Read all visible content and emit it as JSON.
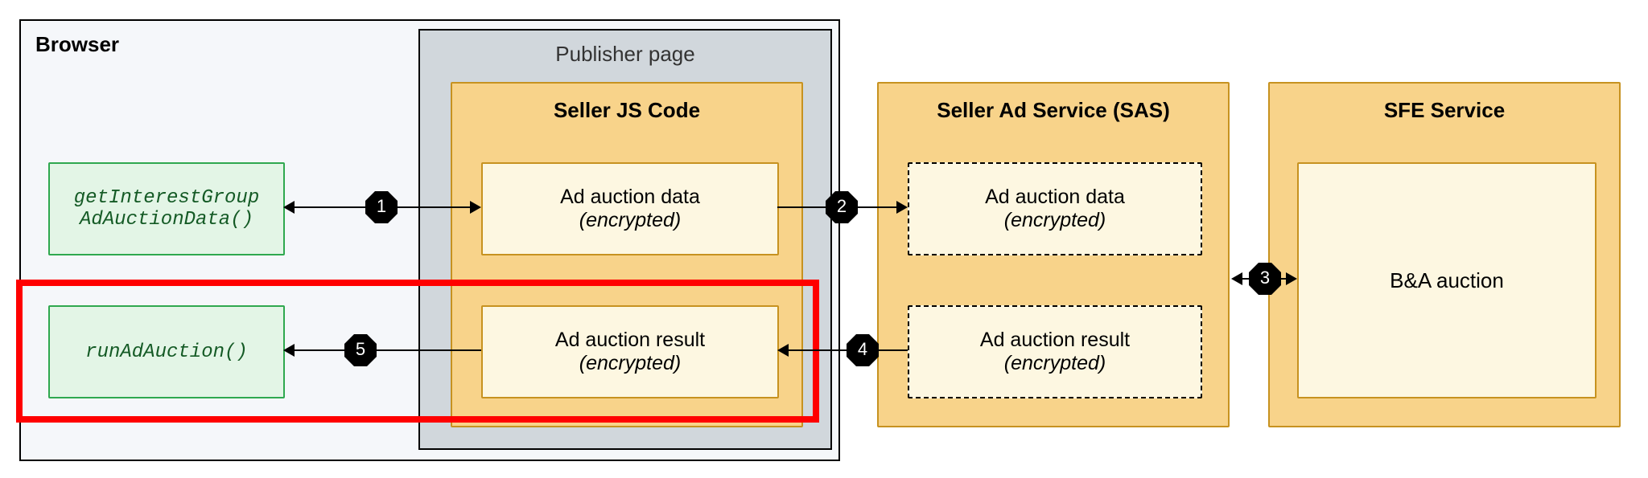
{
  "browser": {
    "title": "Browser"
  },
  "publisher": {
    "title": "Publisher page"
  },
  "seller_js": {
    "title": "Seller JS Code",
    "data_card": {
      "line1": "Ad auction data",
      "line2": "(encrypted)"
    },
    "result_card": {
      "line1": "Ad auction result",
      "line2": "(encrypted)"
    }
  },
  "sas": {
    "title": "Seller Ad Service (SAS)",
    "data_card": {
      "line1": "Ad auction data",
      "line2": "(encrypted)"
    },
    "result_card": {
      "line1": "Ad auction result",
      "line2": "(encrypted)"
    }
  },
  "sfe": {
    "title": "SFE Service",
    "card": {
      "line1": "B&A auction"
    }
  },
  "apis": {
    "get_data": {
      "line1": "getInterestGroup",
      "line2": "AdAuctionData()"
    },
    "run": {
      "line1": "runAdAuction()"
    }
  },
  "steps": {
    "s1": "1",
    "s2": "2",
    "s3": "3",
    "s4": "4",
    "s5": "5"
  }
}
